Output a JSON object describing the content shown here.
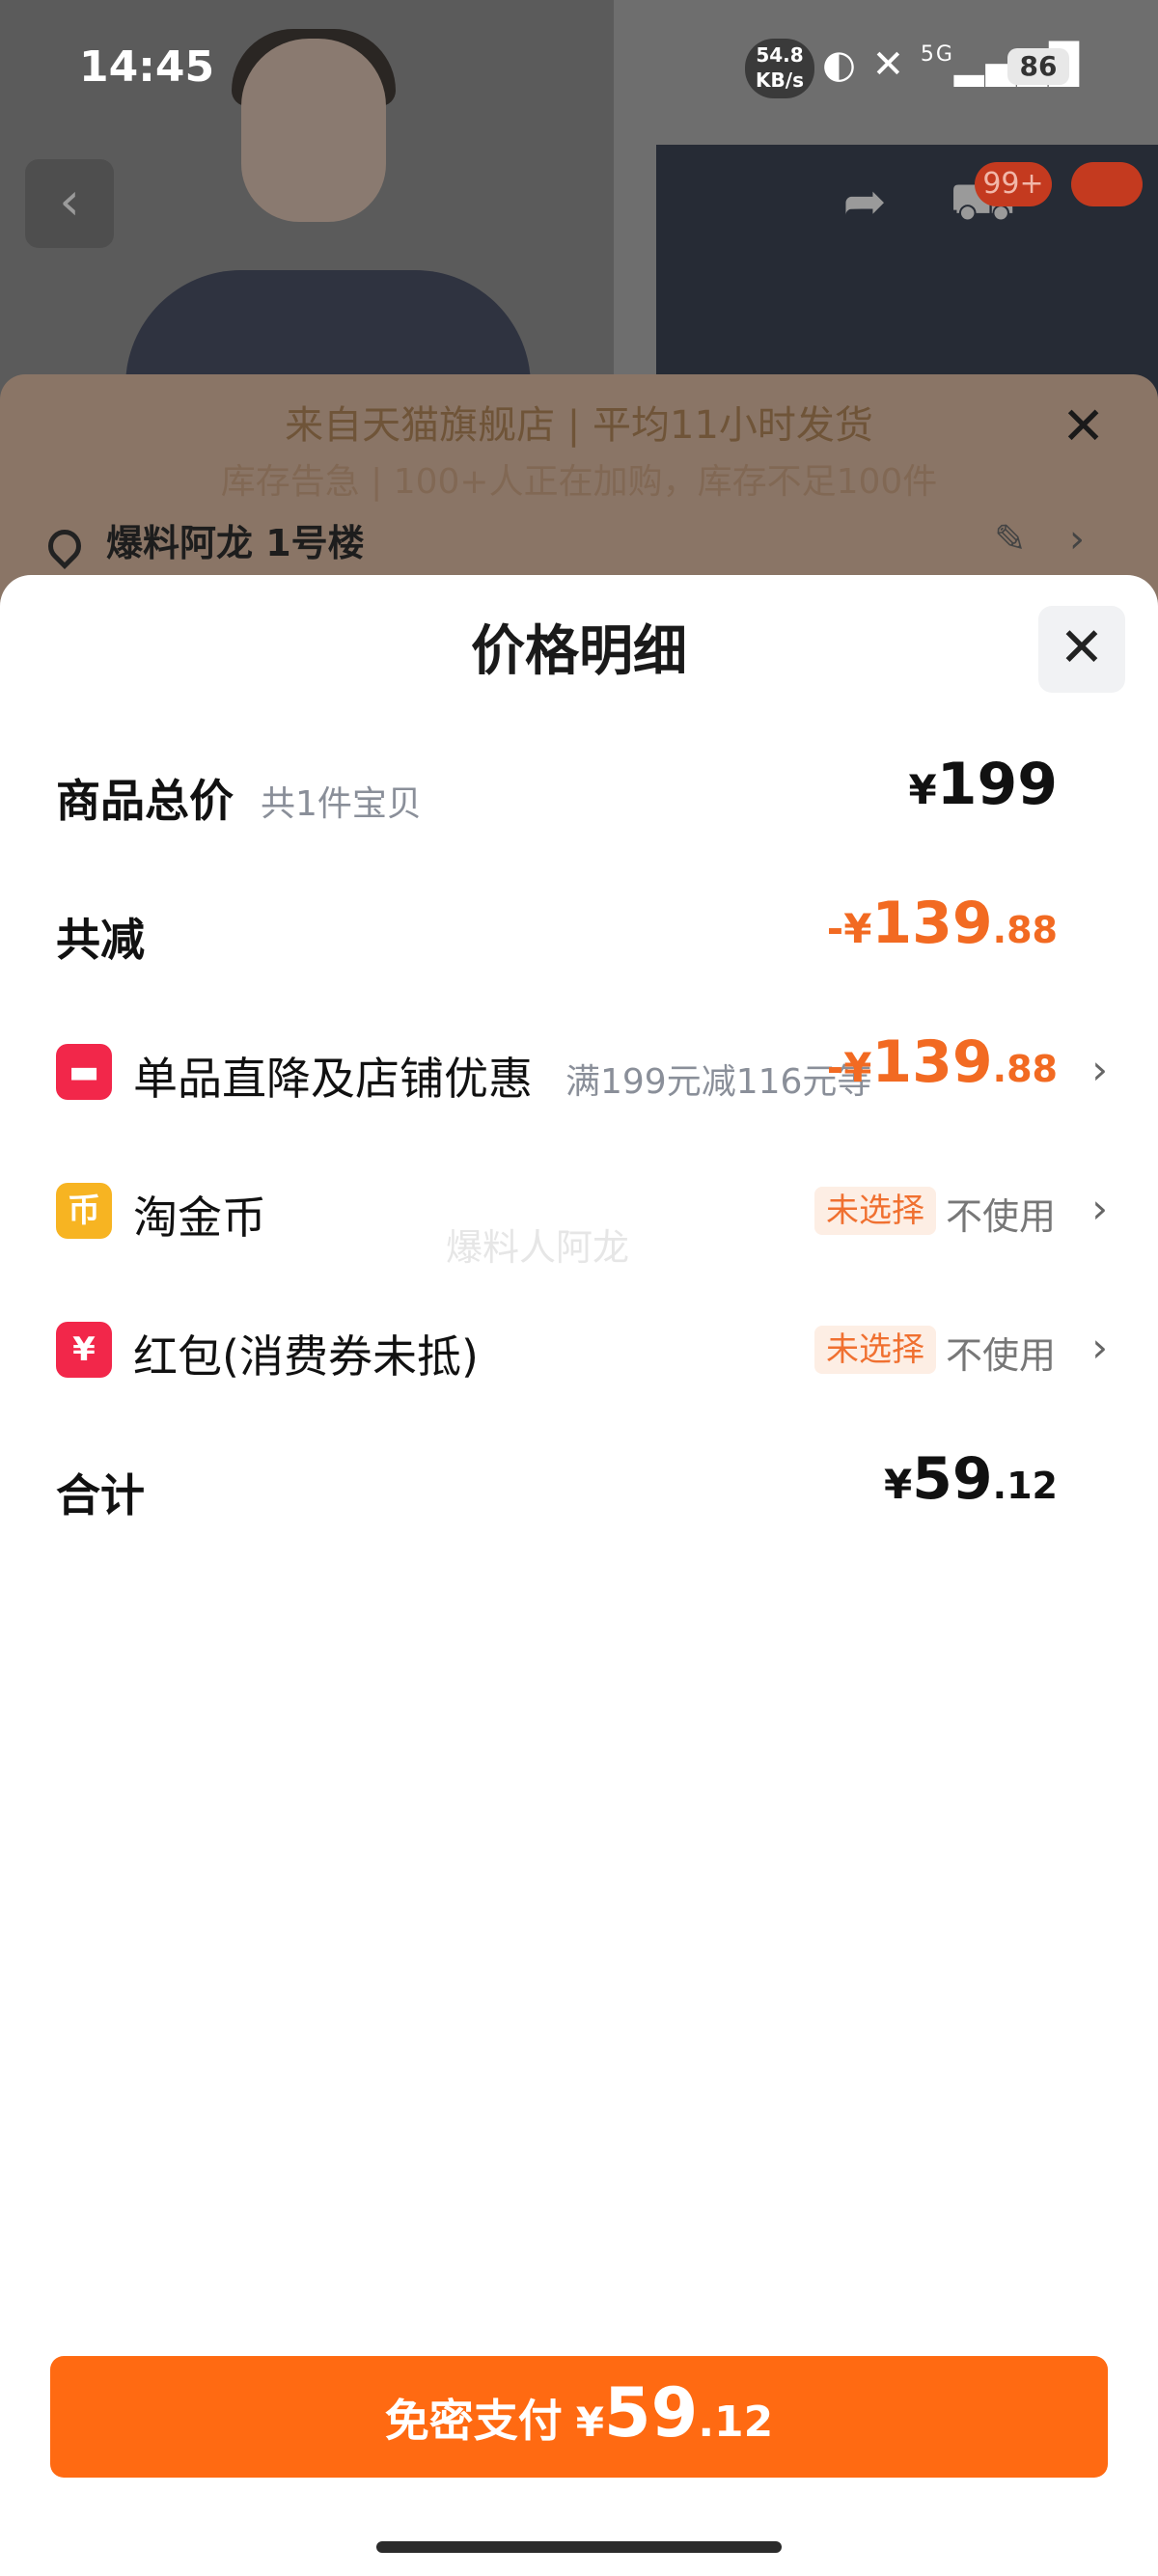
{
  "status": {
    "time": "14:45",
    "net_speed_top": "54.8",
    "net_speed_bottom": "KB/s",
    "signal": "5G",
    "battery": "86"
  },
  "background": {
    "cart_badge": "99+",
    "notice_title": "来自天猫旗舰店 | 平均11小时发货",
    "notice_sub": "库存告急 | 100+人正在加购，库存不足100件",
    "address": "爆料阿龙 1号楼"
  },
  "sheet": {
    "title": "价格明细",
    "rows": [
      {
        "label": "商品总价",
        "sub": "共1件宝贝",
        "yen": "¥",
        "int": "199",
        "dec": ""
      },
      {
        "label": "共减",
        "yen": "-¥",
        "int": "139",
        "dec": ".88"
      },
      {
        "label": "单品直降及店铺优惠",
        "sub": "满199元减116元等",
        "yen": "-¥",
        "int": "139",
        "dec": ".88"
      },
      {
        "label": "淘金币",
        "tag": "未选择",
        "value": "不使用"
      },
      {
        "label": "红包(消费券未抵)",
        "tag": "未选择",
        "value": "不使用"
      },
      {
        "label": "合计",
        "yen": "¥",
        "int": "59",
        "dec": ".12"
      }
    ],
    "watermark": "爆料人阿龙"
  },
  "pay": {
    "label": "免密支付",
    "yen": "¥",
    "int": "59",
    "dec": ".12"
  },
  "icons": {
    "coin": "币",
    "redpacket": "¥"
  }
}
